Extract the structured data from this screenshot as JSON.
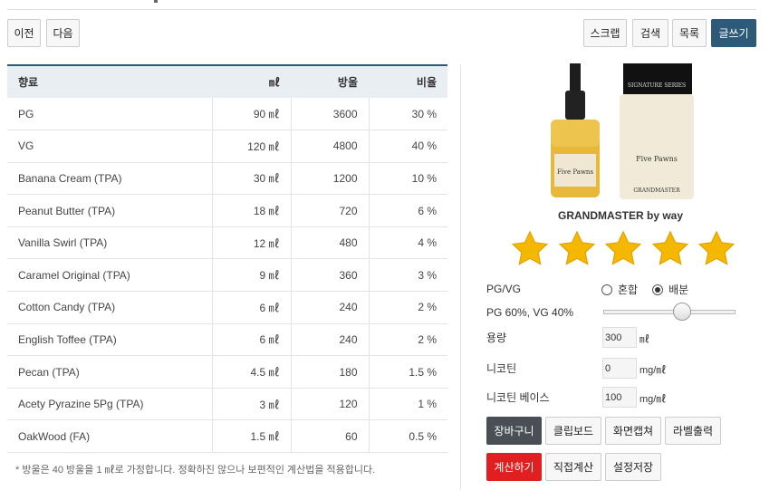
{
  "nav": {
    "prev": "이전",
    "next": "다음"
  },
  "toolbar": {
    "scrap": "스크랩",
    "search": "검색",
    "list": "목록",
    "write": "글쓰기"
  },
  "table": {
    "headers": {
      "flavor": "향료",
      "ml": "㎖",
      "drops": "방울",
      "ratio": "비율"
    },
    "rows": [
      {
        "name": "PG",
        "ml": "90 ㎖",
        "drops": "3600",
        "ratio": "30 %"
      },
      {
        "name": "VG",
        "ml": "120 ㎖",
        "drops": "4800",
        "ratio": "40 %"
      },
      {
        "name": "Banana Cream (TPA)",
        "ml": "30 ㎖",
        "drops": "1200",
        "ratio": "10 %"
      },
      {
        "name": "Peanut Butter (TPA)",
        "ml": "18 ㎖",
        "drops": "720",
        "ratio": "6 %"
      },
      {
        "name": "Vanilla Swirl (TPA)",
        "ml": "12 ㎖",
        "drops": "480",
        "ratio": "4 %"
      },
      {
        "name": "Caramel Original (TPA)",
        "ml": "9 ㎖",
        "drops": "360",
        "ratio": "3 %"
      },
      {
        "name": "Cotton Candy (TPA)",
        "ml": "6 ㎖",
        "drops": "240",
        "ratio": "2 %"
      },
      {
        "name": "English Toffee (TPA)",
        "ml": "6 ㎖",
        "drops": "240",
        "ratio": "2 %"
      },
      {
        "name": "Pecan (TPA)",
        "ml": "4.5 ㎖",
        "drops": "180",
        "ratio": "1.5 %"
      },
      {
        "name": "Acety Pyrazine 5Pg (TPA)",
        "ml": "3 ㎖",
        "drops": "120",
        "ratio": "1 %"
      },
      {
        "name": "OakWood (FA)",
        "ml": "1.5 ㎖",
        "drops": "60",
        "ratio": "0.5 %"
      }
    ],
    "note": "* 방울은 40 방울을 1 ㎖로 가정합니다. 정확하진 않으나 보편적인 계산법을 적용합니다."
  },
  "product": {
    "title": "GRANDMASTER by way",
    "bottle_text": {
      "brand": "Five Pawns",
      "series": "SIGNATURE SERIES",
      "name": "GRANDMASTER"
    },
    "rating": 5,
    "star_color": "#f5b800"
  },
  "form": {
    "pgvg_label": "PG/VG",
    "mix_option": "혼합",
    "split_option": "배분",
    "ratio_text": "PG 60%, VG 40%",
    "ratio_value": 0.6,
    "volume_label": "용량",
    "volume_value": "300",
    "volume_unit": "㎖",
    "nicotine_label": "니코틴",
    "nicotine_value": "0",
    "nicotine_unit": "mg/㎖",
    "base_label": "니코틴 베이스",
    "base_value": "100",
    "base_unit": "mg/㎖"
  },
  "actions": {
    "cart": "장바구니",
    "clipboard": "클립보드",
    "capture": "화면캡쳐",
    "label_print": "라벨출력",
    "calculate": "계산하기",
    "manual_calc": "직접계산",
    "save_settings": "설정저장"
  },
  "colors": {
    "accent": "#2e5a7a",
    "danger": "#e02020",
    "dark": "#4a4f55"
  }
}
